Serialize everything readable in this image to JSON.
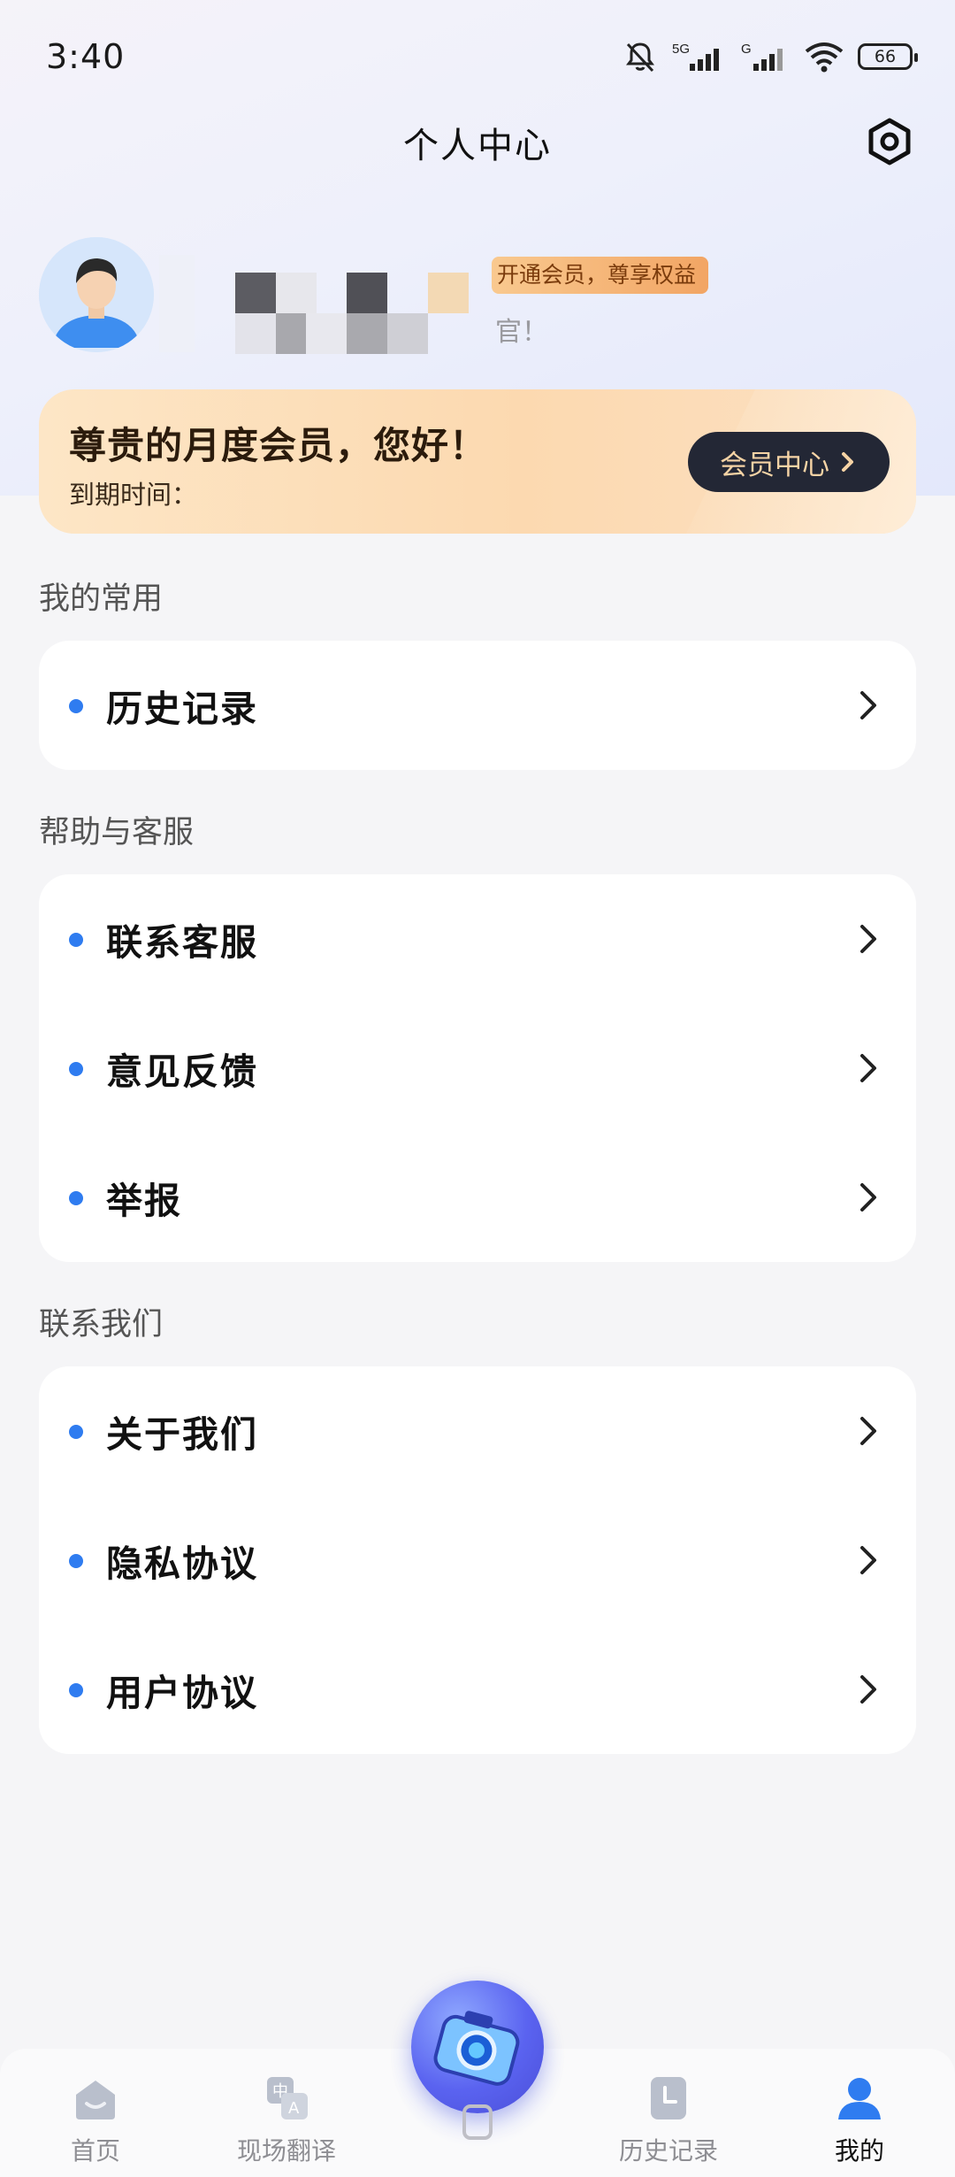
{
  "status_bar": {
    "time": "3:40",
    "network_1": "5G",
    "network_2": "G",
    "battery": "66"
  },
  "header": {
    "title": "个人中心",
    "settings_icon": "settings-hexagon-icon"
  },
  "profile": {
    "vip_tag": "开通会员，尊享权益",
    "hint": "官！"
  },
  "member_banner": {
    "greeting": "尊贵的月度会员，您好！",
    "expire_label": "到期时间：",
    "center_button": "会员中心"
  },
  "sections": [
    {
      "title": "我的常用",
      "items": [
        {
          "label": "历史记录"
        }
      ]
    },
    {
      "title": "帮助与客服",
      "items": [
        {
          "label": "联系客服"
        },
        {
          "label": "意见反馈"
        },
        {
          "label": "举报"
        }
      ]
    },
    {
      "title": "联系我们",
      "items": [
        {
          "label": "关于我们"
        },
        {
          "label": "隐私协议"
        },
        {
          "label": "用户协议"
        }
      ]
    }
  ],
  "bottom_nav": {
    "items": [
      {
        "label": "首页",
        "icon": "home-icon"
      },
      {
        "label": "现场翻译",
        "icon": "translate-icon"
      },
      {
        "label": "历史记录",
        "icon": "history-icon"
      },
      {
        "label": "我的",
        "icon": "profile-icon",
        "active": true
      }
    ],
    "center_icon": "camera-icon"
  },
  "colors": {
    "accent_dot": "#2f7cf0",
    "nav_active": "#2f7cf0",
    "member_button_bg": "#232735",
    "member_button_text": "#f5d3a5"
  }
}
